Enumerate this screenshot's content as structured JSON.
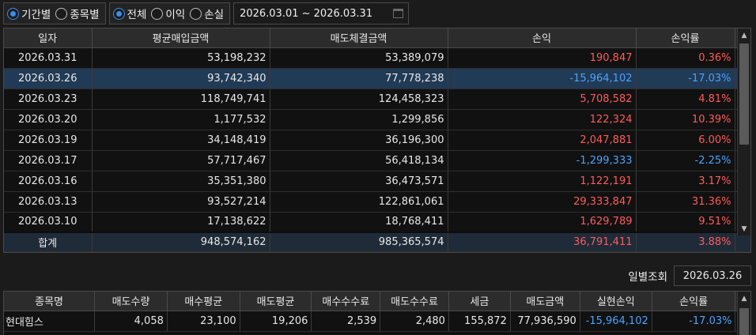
{
  "filters": {
    "period_group": [
      {
        "label": "기간별",
        "selected": true
      },
      {
        "label": "종목별",
        "selected": false
      }
    ],
    "type_group": [
      {
        "label": "전체",
        "selected": true
      },
      {
        "label": "이익",
        "selected": false
      },
      {
        "label": "손실",
        "selected": false
      }
    ],
    "date_range": "2026.03.01 ~ 2026.03.31",
    "date_range_icon": "calendar-icon"
  },
  "daily_table": {
    "columns": [
      "일자",
      "평균매입금액",
      "매도체결금액",
      "손익",
      "손익률"
    ],
    "rows": [
      {
        "date": "2026.03.31",
        "buy": "53,198,232",
        "sell": "53,389,079",
        "pnl": "190,847",
        "rate": "0.36%",
        "sign": "pos",
        "selected": false
      },
      {
        "date": "2026.03.26",
        "buy": "93,742,340",
        "sell": "77,778,238",
        "pnl": "-15,964,102",
        "rate": "-17.03%",
        "sign": "neg",
        "selected": true
      },
      {
        "date": "2026.03.23",
        "buy": "118,749,741",
        "sell": "124,458,323",
        "pnl": "5,708,582",
        "rate": "4.81%",
        "sign": "pos",
        "selected": false
      },
      {
        "date": "2026.03.20",
        "buy": "1,177,532",
        "sell": "1,299,856",
        "pnl": "122,324",
        "rate": "10.39%",
        "sign": "pos",
        "selected": false
      },
      {
        "date": "2026.03.19",
        "buy": "34,148,419",
        "sell": "36,196,300",
        "pnl": "2,047,881",
        "rate": "6.00%",
        "sign": "pos",
        "selected": false
      },
      {
        "date": "2026.03.17",
        "buy": "57,717,467",
        "sell": "56,418,134",
        "pnl": "-1,299,333",
        "rate": "-2.25%",
        "sign": "neg",
        "selected": false
      },
      {
        "date": "2026.03.16",
        "buy": "35,351,380",
        "sell": "36,473,571",
        "pnl": "1,122,191",
        "rate": "3.17%",
        "sign": "pos",
        "selected": false
      },
      {
        "date": "2026.03.13",
        "buy": "93,527,214",
        "sell": "122,861,061",
        "pnl": "29,333,847",
        "rate": "31.36%",
        "sign": "pos",
        "selected": false
      },
      {
        "date": "2026.03.10",
        "buy": "17,138,622",
        "sell": "18,768,411",
        "pnl": "1,629,789",
        "rate": "9.51%",
        "sign": "pos",
        "selected": false
      }
    ],
    "total": {
      "label": "합계",
      "buy": "948,574,162",
      "sell": "985,365,574",
      "pnl": "36,791,411",
      "rate": "3.88%",
      "sign": "pos"
    }
  },
  "daily_lookup": {
    "label": "일별조회",
    "date": "2026.03.26"
  },
  "stock_table": {
    "columns": [
      "종목명",
      "매도수량",
      "매수평균",
      "매도평균",
      "매수수수료",
      "매도수수료",
      "세금",
      "매도금액",
      "실현손익",
      "손익률"
    ],
    "rows": [
      {
        "cells": [
          "현대힘스",
          "4,058",
          "23,100",
          "19,206",
          "2,539",
          "2,480",
          "155,872",
          "77,936,590",
          "-15,964,102",
          "-17.03%"
        ],
        "sign": "neg"
      }
    ]
  },
  "scroll_icons": {
    "up": "▲",
    "down": "▼"
  }
}
